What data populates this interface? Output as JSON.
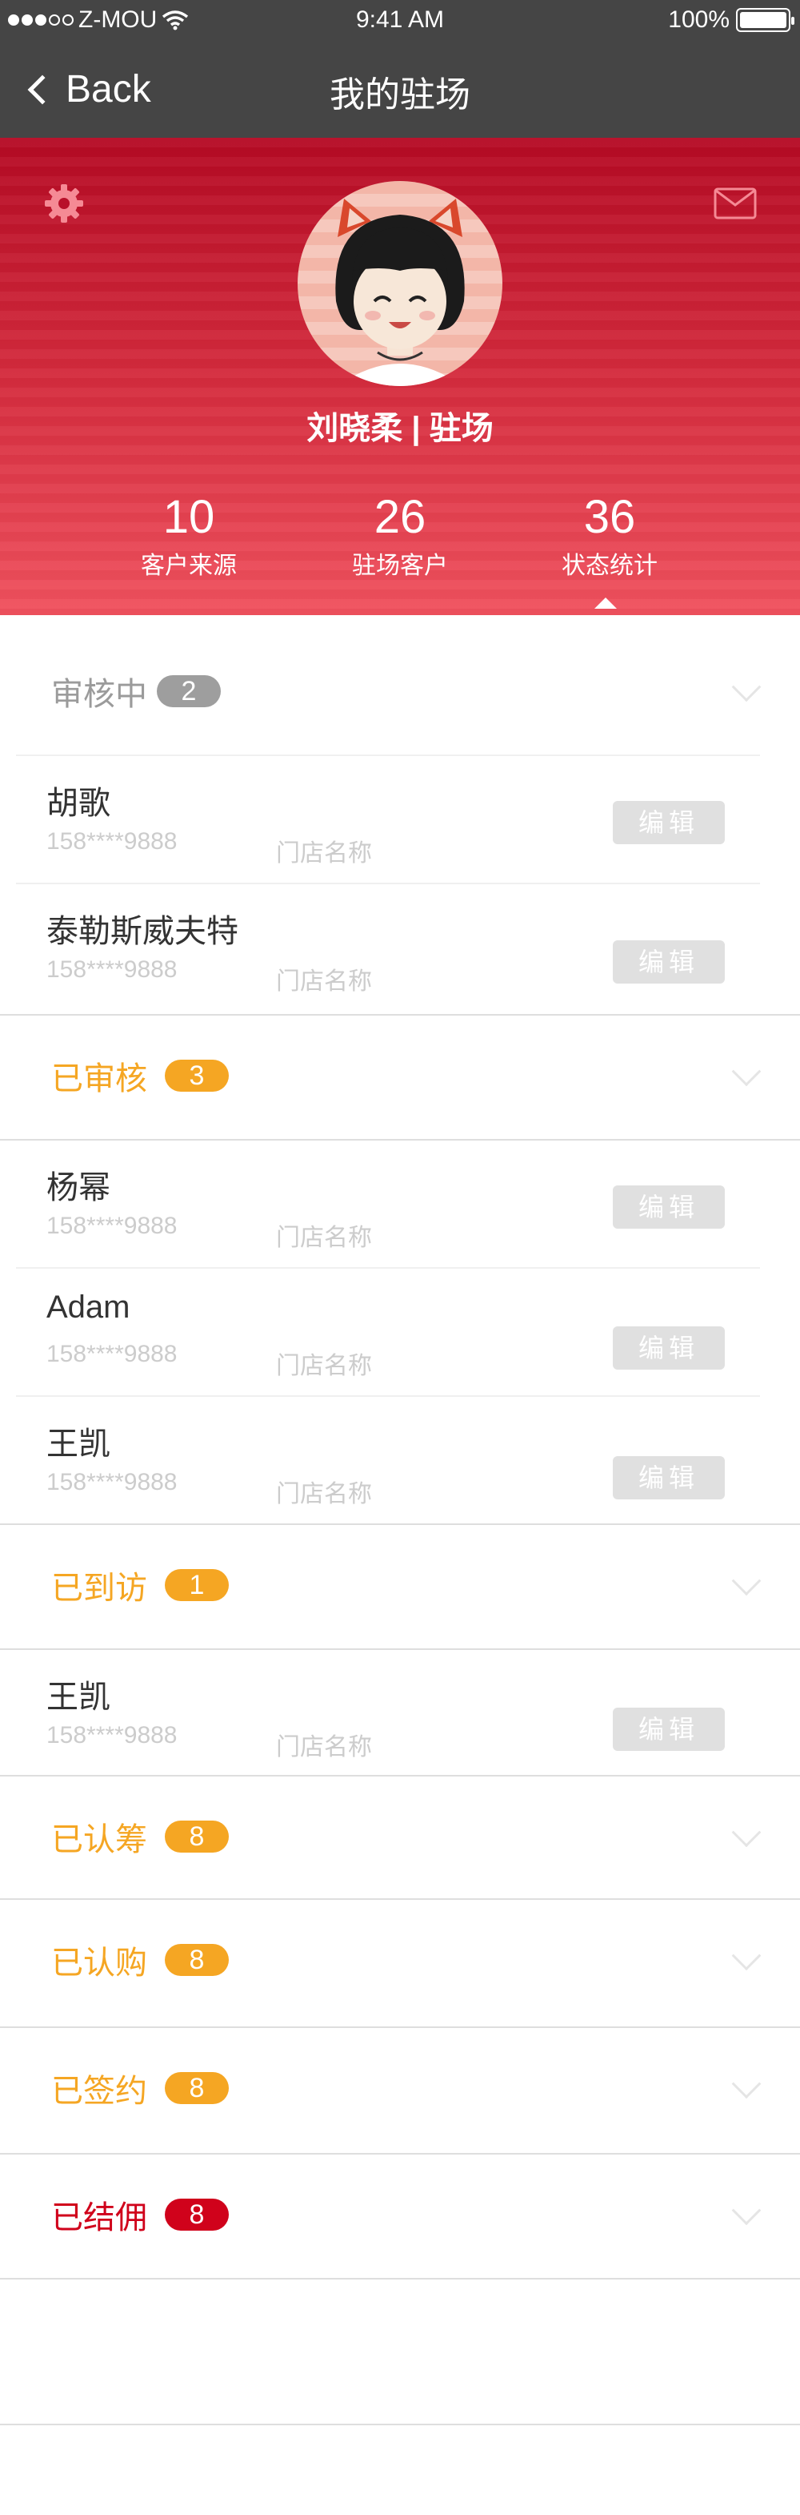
{
  "status_bar": {
    "carrier": "Z-MOU",
    "time": "9:41 AM",
    "battery": "100%"
  },
  "nav": {
    "back_label": "Back",
    "title": "我的驻场"
  },
  "profile": {
    "name": "刘晓柔 | 驻场",
    "stats": [
      {
        "value": "10",
        "label": "客户来源"
      },
      {
        "value": "26",
        "label": "驻场客户"
      },
      {
        "value": "36",
        "label": "状态统计"
      }
    ]
  },
  "icons": {
    "settings": "gear-icon",
    "messages": "mail-icon",
    "expand": "chevron-down-icon"
  },
  "colors": {
    "nav_bg": "#454545",
    "header_red": "#c8172e",
    "orange": "#f5a623",
    "gray_badge": "#9e9e9e",
    "red_badge": "#d0021b"
  },
  "sections": [
    {
      "title": "审核中",
      "count": "2",
      "rows": [
        {
          "name": "胡歌",
          "phone": "158****9888",
          "store": "门店名称",
          "edit": "编辑"
        },
        {
          "name": "泰勒斯威夫特",
          "phone": "158****9888",
          "store": "门店名称",
          "edit": "编辑"
        }
      ]
    },
    {
      "title": "已审核",
      "count": "3",
      "rows": [
        {
          "name": "杨幂",
          "phone": "158****9888",
          "store": "门店名称",
          "edit": "编辑"
        },
        {
          "name": "Adam",
          "phone": "158****9888",
          "store": "门店名称",
          "edit": "编辑"
        },
        {
          "name": "王凯",
          "phone": "158****9888",
          "store": "门店名称",
          "edit": "编辑"
        }
      ]
    },
    {
      "title": "已到访",
      "count": "1",
      "rows": [
        {
          "name": "王凯",
          "phone": "158****9888",
          "store": "门店名称",
          "edit": "编辑"
        }
      ]
    },
    {
      "title": "已认筹",
      "count": "8",
      "rows": []
    },
    {
      "title": "已认购",
      "count": "8",
      "rows": []
    },
    {
      "title": "已签约",
      "count": "8",
      "rows": []
    },
    {
      "title": "已结佣",
      "count": "8",
      "rows": []
    }
  ]
}
